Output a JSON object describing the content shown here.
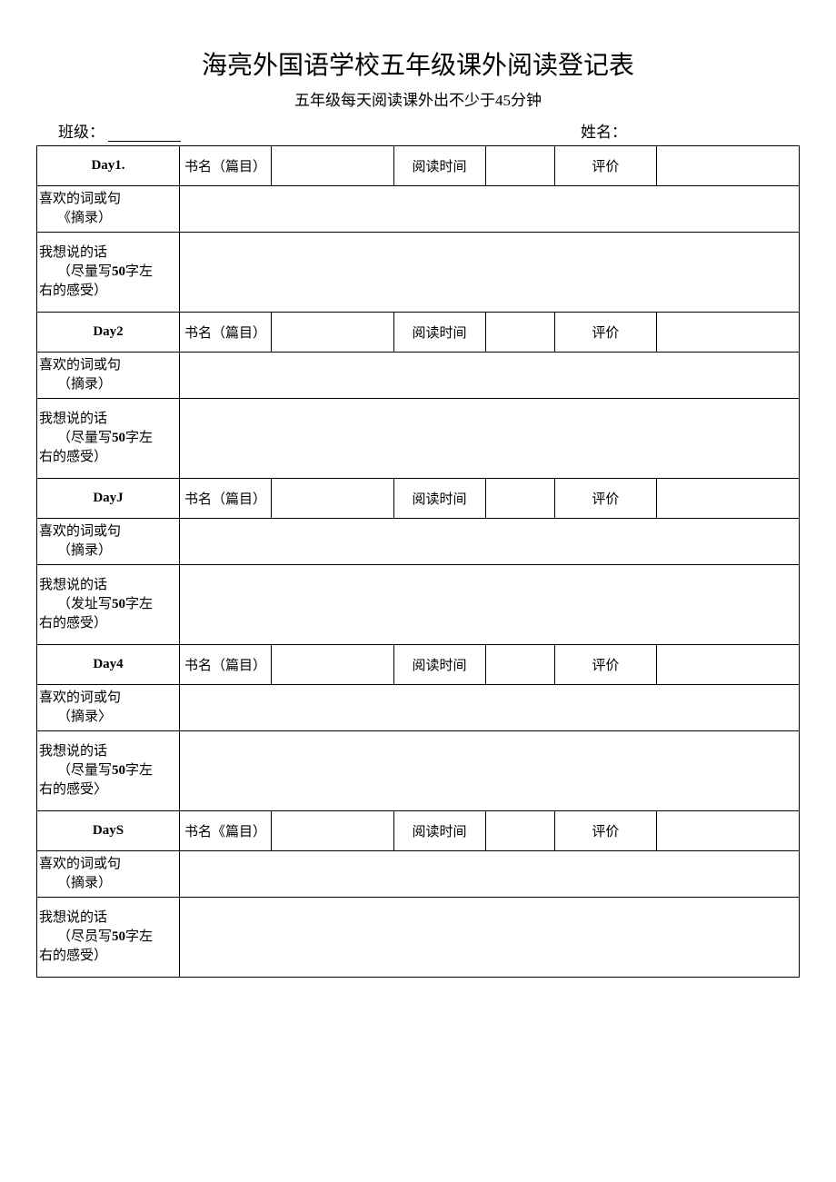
{
  "title": "海亮外国语学校五年级课外阅读登记表",
  "subtitle": "五年级每天阅读课外出不少于45分钟",
  "class_label": "班级：",
  "name_label": "姓名：",
  "col_book": "书名（篇目）",
  "col_time": "阅读时间",
  "col_eval": "评价",
  "row_words": "喜欢的词或句",
  "row_words_sub": "《摘录）",
  "row_words_sub2": "（摘录）",
  "row_words_sub3": "（摘录〉",
  "row_thoughts": "我想说的话",
  "row_thoughts_sub1": "（尽量写50字左右的感受）",
  "row_thoughts_sub2": "（发址写50字左右的感受）",
  "row_thoughts_sub3": "（尽量写50字左右的感受〉",
  "row_thoughts_sub4": "（尽员写50字左右的感受）",
  "days": {
    "d1": "Day1.",
    "d2": "Day2",
    "d3": "DayJ",
    "d4": "Day4",
    "d5": "DayS"
  },
  "book_col5": "书名《篇目）"
}
